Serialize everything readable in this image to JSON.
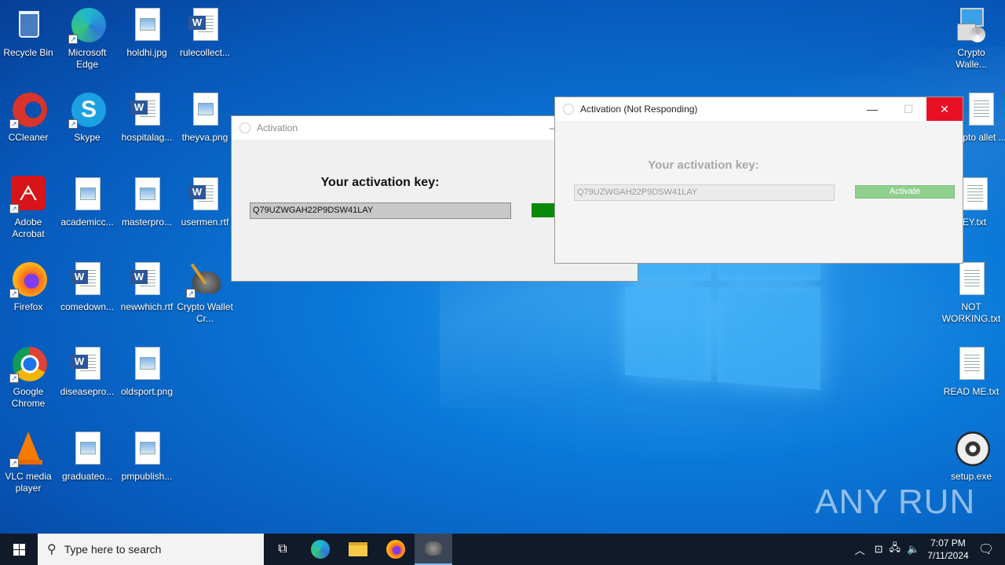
{
  "desktop": {
    "icons_left": [
      {
        "label": "Recycle Bin",
        "icon": "recycle-bin-icon"
      },
      {
        "label": "Microsoft Edge",
        "icon": "edge-icon"
      },
      {
        "label": "holdhi.jpg",
        "icon": "image-file-icon"
      },
      {
        "label": "rulecollect...",
        "icon": "word-doc-icon"
      },
      {
        "label": "CCleaner",
        "icon": "ccleaner-icon"
      },
      {
        "label": "Skype",
        "icon": "skype-icon"
      },
      {
        "label": "hospitalag...",
        "icon": "word-doc-icon"
      },
      {
        "label": "theyva.png",
        "icon": "image-file-icon"
      },
      {
        "label": "Adobe Acrobat",
        "icon": "acrobat-icon"
      },
      {
        "label": "academicc...",
        "icon": "image-file-icon"
      },
      {
        "label": "masterpro...",
        "icon": "image-file-icon"
      },
      {
        "label": "usermen.rtf",
        "icon": "word-doc-icon"
      },
      {
        "label": "Firefox",
        "icon": "firefox-icon"
      },
      {
        "label": "comedown...",
        "icon": "word-doc-icon"
      },
      {
        "label": "newwhich.rtf",
        "icon": "word-doc-icon"
      },
      {
        "label": "Crypto Wallet Cr...",
        "icon": "crypto-wallet-icon"
      },
      {
        "label": "Google Chrome",
        "icon": "chrome-icon"
      },
      {
        "label": "diseasepro...",
        "icon": "word-doc-icon"
      },
      {
        "label": "oldsport.png",
        "icon": "image-file-icon"
      },
      {
        "label": "VLC media player",
        "icon": "vlc-icon"
      },
      {
        "label": "graduateo...",
        "icon": "image-file-icon"
      },
      {
        "label": "pmpublish...",
        "icon": "image-file-icon"
      }
    ],
    "icons_right": [
      {
        "label": "Crypto Walle...",
        "icon": "installer-icon"
      },
      {
        "label": "rypto allet ...",
        "icon": "text-file-icon"
      },
      {
        "label": "EY.txt",
        "icon": "text-file-icon"
      },
      {
        "label": "NOT WORKING.txt",
        "icon": "text-file-icon"
      },
      {
        "label": "READ ME.txt",
        "icon": "text-file-icon"
      },
      {
        "label": "setup.exe",
        "icon": "setup-disc-icon"
      }
    ],
    "watermark": "ANY RUN"
  },
  "window_back": {
    "title": "Activation",
    "heading": "Your activation key:",
    "key": "Q79UZWGAH22P9DSW41LAY",
    "colors": {
      "button": "#0a8a0a"
    }
  },
  "window_front": {
    "title": "Activation (Not Responding)",
    "heading": "Your activation key:",
    "key": "Q79UZWGAH22P9DSW41LAY",
    "button_label": "Activate",
    "colors": {
      "close": "#e81123",
      "button": "#8fd08f"
    }
  },
  "taskbar": {
    "search_placeholder": "Type here to search",
    "time": "7:07 PM",
    "date": "7/11/2024"
  }
}
